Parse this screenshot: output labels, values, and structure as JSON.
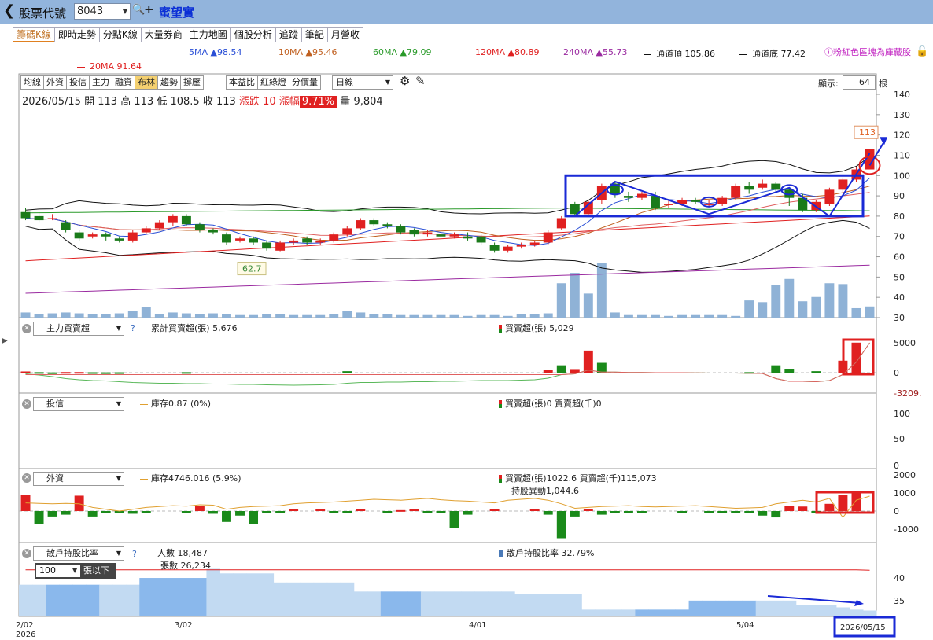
{
  "header": {
    "title": "股票代號",
    "stock_code": "8043",
    "stock_name": "蜜望實"
  },
  "tabs": [
    "籌碼K線",
    "即時走勢",
    "分點K線",
    "大量券商",
    "主力地圖",
    "個股分析",
    "追蹤",
    "筆記",
    "月營收"
  ],
  "ma_legend": [
    {
      "label": "5MA ▲98.54",
      "color": "#2a4fd6"
    },
    {
      "label": "10MA ▲95.46",
      "color": "#c06020"
    },
    {
      "label": "60MA ▲79.09",
      "color": "#2a9a2a"
    },
    {
      "label": "120MA ▲80.89",
      "color": "#e02020"
    },
    {
      "label": "240MA ▲55.73",
      "color": "#9a2aa0"
    },
    {
      "label": "通道頂 105.86",
      "color": "#111111"
    },
    {
      "label": "通道底 77.42",
      "color": "#111111"
    },
    {
      "label": "20MA 91.64",
      "color": "#e02020"
    }
  ],
  "legend_note": "ⓘ粉紅色區塊為庫藏股",
  "toolbar": [
    "均線",
    "外資",
    "投信",
    "主力",
    "融資",
    "布林",
    "趨勢",
    "撐壓",
    "本益比",
    "紅綠燈",
    "分價量"
  ],
  "period": "日線",
  "display": {
    "label": "顯示:",
    "value": "64",
    "unit": "根"
  },
  "ohlc": {
    "date": "2026/05/15",
    "open_label": "開",
    "open": "113",
    "high_label": "高",
    "high": "113",
    "low_label": "低",
    "low": "108.5",
    "close_label": "收",
    "close": "113",
    "change_label": "漲跌",
    "change": "10",
    "pct_label": "漲幅",
    "pct": "9.71%",
    "vol_label": "量",
    "vol": "9,804"
  },
  "panels": {
    "main_force": {
      "select": "主力買賣超",
      "line_label": "累計買賣超(張) 5,676",
      "bar_label": "買賣超(張) 5,029"
    },
    "trust": {
      "select": "投信",
      "line_label": "庫存0.87 (0%)",
      "bar_label": "買賣超(張)0 買賣超(千)0"
    },
    "foreign": {
      "select": "外資",
      "line_label": "庫存4746.016 (5.9%)",
      "bar_label": "買賣超(張)1022.6 買賣超(千)115,073",
      "bar_label2": "持股異動1,044.6"
    },
    "retail": {
      "select": "散戶持股比率",
      "line_label": "人數 18,487",
      "line_label2": "張數 26,234",
      "bar_label": "散戶持股比率 32.79%",
      "unit_value": "100",
      "unit_label": "張以下"
    }
  },
  "chart_data": {
    "type": "candlestick",
    "price_axis": {
      "min": 30,
      "max": 140,
      "ticks": [
        "140",
        "130",
        "120",
        "110",
        "100",
        "90",
        "80",
        "70",
        "60",
        "50",
        "40",
        "30"
      ]
    },
    "main_force_axis": {
      "ticks": [
        "5000",
        "0",
        "-3209."
      ]
    },
    "trust_axis": {
      "ticks": [
        "100",
        "50",
        "0"
      ]
    },
    "foreign_axis": {
      "ticks": [
        "2000",
        "1000",
        "0",
        "-1000"
      ]
    },
    "retail_axis": {
      "ticks": [
        "40",
        "35"
      ]
    },
    "x_labels": [
      {
        "i": 0,
        "label": "2/02"
      },
      {
        "i": 0,
        "label": "2026"
      },
      {
        "i": 14,
        "label": "3/02"
      },
      {
        "i": 37,
        "label": "4/01"
      },
      {
        "i": 57,
        "label": "5/04"
      },
      {
        "i": 63,
        "label": "2026/05/15"
      }
    ],
    "labels": {
      "high_tag": "113",
      "low_tag": "62.7"
    },
    "candles": [
      [
        82,
        79,
        84,
        78
      ],
      [
        80,
        78,
        82,
        77
      ],
      [
        79,
        79,
        81,
        78
      ],
      [
        77,
        73,
        78,
        72
      ],
      [
        72,
        69,
        73,
        68
      ],
      [
        70,
        71,
        72,
        69
      ],
      [
        71,
        70,
        72,
        68
      ],
      [
        69,
        68,
        70,
        67
      ],
      [
        68,
        72,
        73,
        67
      ],
      [
        72,
        74,
        75,
        71
      ],
      [
        74,
        77,
        78,
        73
      ],
      [
        77,
        80,
        81,
        75
      ],
      [
        80,
        76,
        81,
        75
      ],
      [
        76,
        73,
        77,
        72
      ],
      [
        73,
        72,
        74,
        71
      ],
      [
        71,
        67,
        72,
        66
      ],
      [
        68,
        69,
        70,
        67
      ],
      [
        69,
        67,
        70,
        66
      ],
      [
        67,
        64,
        68,
        63
      ],
      [
        63,
        67,
        68,
        62.7
      ],
      [
        67,
        68,
        69,
        66
      ],
      [
        69,
        67,
        70,
        66
      ],
      [
        67,
        68,
        69,
        66
      ],
      [
        68,
        71,
        72,
        67
      ],
      [
        71,
        74,
        75,
        70
      ],
      [
        74,
        78,
        79,
        73
      ],
      [
        78,
        76,
        79,
        75
      ],
      [
        76,
        75,
        77,
        74
      ],
      [
        75,
        72,
        76,
        71
      ],
      [
        73,
        71,
        74,
        70
      ],
      [
        71,
        72,
        73,
        70
      ],
      [
        71,
        70,
        73,
        69
      ],
      [
        70,
        71,
        72,
        69
      ],
      [
        70,
        69,
        72,
        68
      ],
      [
        70,
        67,
        71,
        66
      ],
      [
        66,
        63,
        67,
        62
      ],
      [
        63,
        65,
        66,
        62
      ],
      [
        65,
        66,
        67,
        64
      ],
      [
        66,
        67,
        68,
        65
      ],
      [
        67,
        72,
        73,
        66
      ],
      [
        74,
        79,
        80,
        73
      ],
      [
        86,
        81,
        87,
        80
      ],
      [
        81,
        87,
        88,
        80
      ],
      [
        88,
        95,
        96,
        86
      ],
      [
        96,
        91,
        97,
        89
      ],
      [
        90,
        89,
        92,
        87
      ],
      [
        89,
        91,
        92,
        88
      ],
      [
        90,
        84,
        92,
        83
      ],
      [
        86,
        86,
        88,
        84
      ],
      [
        86,
        88,
        89,
        85
      ],
      [
        88,
        87,
        89,
        86
      ],
      [
        86,
        86,
        88,
        85
      ],
      [
        86,
        89,
        90,
        85
      ],
      [
        89,
        95,
        96,
        88
      ],
      [
        95,
        93,
        97,
        91
      ],
      [
        94,
        96,
        98,
        93
      ],
      [
        96,
        93,
        97,
        92
      ],
      [
        93,
        89,
        94,
        85
      ],
      [
        89,
        83,
        91,
        82
      ],
      [
        83,
        87,
        88,
        82
      ],
      [
        86,
        93,
        94,
        85
      ],
      [
        93,
        98,
        99,
        92
      ],
      [
        98,
        103,
        104,
        97
      ],
      [
        103,
        113,
        113,
        108.5
      ]
    ],
    "volume": [
      6,
      4,
      5,
      6,
      5,
      4,
      4,
      5,
      8,
      12,
      4,
      6,
      5,
      4,
      5,
      4,
      3,
      3,
      4,
      4,
      3,
      3,
      3,
      4,
      8,
      6,
      4,
      4,
      3,
      3,
      3,
      3,
      3,
      2,
      3,
      3,
      2,
      4,
      4,
      5,
      40,
      52,
      28,
      64,
      6,
      3,
      3,
      3,
      2,
      3,
      3,
      3,
      3,
      2,
      20,
      18,
      38,
      45,
      19,
      24,
      40,
      39,
      11,
      13
    ],
    "main_force_bars": [
      200,
      -100,
      -50,
      100,
      100,
      -80,
      -60,
      -70,
      0,
      0,
      0,
      0,
      -100,
      0,
      0,
      0,
      0,
      0,
      0,
      0,
      0,
      0,
      0,
      0,
      -300,
      0,
      0,
      0,
      0,
      0,
      0,
      0,
      0,
      0,
      0,
      0,
      0,
      0,
      0,
      400,
      -1500,
      600,
      3700,
      -2000,
      0,
      0,
      0,
      0,
      0,
      0,
      0,
      0,
      0,
      0,
      -100,
      0,
      -1500,
      -800,
      0,
      -300,
      0,
      2000,
      5029,
      0
    ],
    "main_force_line": [
      -300,
      -600,
      -1000,
      -1500,
      -1800,
      -2000,
      -2100,
      -2300,
      -2500,
      -2600,
      -2700,
      -2700,
      -2800,
      -2800,
      -2900,
      -2900,
      -3000,
      -3000,
      -3100,
      -3150,
      -3209,
      -3150,
      -3100,
      -3000,
      -2700,
      -2500,
      -2500,
      -2400,
      -2400,
      -2300,
      -2300,
      -2200,
      -2200,
      -2100,
      -2000,
      -2000,
      -2000,
      -1900,
      -1800,
      -1400,
      -500,
      -300,
      500,
      100,
      100,
      50,
      50,
      0,
      0,
      0,
      -50,
      -100,
      -100,
      -100,
      -150,
      -200,
      -1500,
      -2200,
      -2200,
      -2300,
      -2000,
      -500,
      2000,
      5676
    ],
    "foreign_bars": [
      900,
      -700,
      -300,
      -200,
      850,
      -300,
      -100,
      -50,
      -150,
      -50,
      0,
      0,
      -50,
      300,
      -150,
      -600,
      -250,
      -700,
      -50,
      -50,
      100,
      0,
      100,
      -100,
      -50,
      100,
      0,
      -50,
      50,
      100,
      -50,
      -50,
      -950,
      -200,
      0,
      100,
      0,
      0,
      100,
      -200,
      -1500,
      -300,
      100,
      -200,
      -100,
      -100,
      -100,
      0,
      0,
      -50,
      0,
      -50,
      -100,
      -50,
      -50,
      -250,
      -350,
      300,
      250,
      -100,
      400,
      900,
      1022,
      0
    ],
    "foreign_line": [
      300,
      250,
      200,
      250,
      200,
      -200,
      -400,
      -600,
      -400,
      -200,
      -100,
      0,
      -50,
      100,
      50,
      -400,
      -200,
      -100,
      -50,
      0,
      200,
      300,
      350,
      400,
      500,
      600,
      700,
      650,
      600,
      700,
      800,
      650,
      550,
      500,
      400,
      300,
      600,
      700,
      800,
      600,
      200,
      -300,
      -200,
      -100,
      -50,
      0,
      -100,
      -150,
      -100,
      -50,
      0,
      -100,
      -200,
      -300,
      -250,
      -200,
      200,
      400,
      600,
      400,
      800,
      -1300,
      600,
      1050
    ],
    "retail_area": [
      38.5,
      38.5,
      38.5,
      38.5,
      38.5,
      38.5,
      38.5,
      38.5,
      38.5,
      40,
      40,
      40,
      40,
      40,
      42,
      41,
      41,
      41,
      41,
      39,
      39,
      39,
      39,
      39,
      39,
      37,
      37,
      37,
      37,
      37,
      37,
      37,
      37,
      37,
      37,
      37,
      37,
      36.5,
      36.5,
      36.5,
      36.5,
      36.5,
      33,
      33,
      33,
      33,
      33,
      33,
      33,
      33,
      35,
      35,
      35,
      35,
      35,
      35,
      35,
      35,
      34,
      34,
      34,
      33.5,
      33,
      32.8
    ],
    "retail_line": [
      41.8,
      41.8,
      41.8,
      41.8,
      41.8,
      41.8,
      41.8,
      41.8,
      41.8,
      41.8,
      41.8,
      41.8,
      41.8,
      41.8,
      41.8,
      41.8,
      41.8,
      41.8,
      41.8,
      41.8,
      41.8,
      41.8,
      41.8,
      41.8,
      41.8,
      41.8,
      41.8,
      41.8,
      41.8,
      41.8,
      41.8,
      41.8,
      41.8,
      41.8,
      41.8,
      41.8,
      41.8,
      41.8,
      41.8,
      41.8,
      41.8,
      41.8,
      41.8,
      41.8,
      41.8,
      41.8,
      41.8,
      41.8,
      41.8,
      41.8,
      41.8,
      41.8,
      41.8,
      41.8,
      41.8,
      41.8,
      41.8,
      41.8,
      41.8,
      41.8,
      41.8,
      41.8,
      41.8,
      41.7
    ]
  }
}
